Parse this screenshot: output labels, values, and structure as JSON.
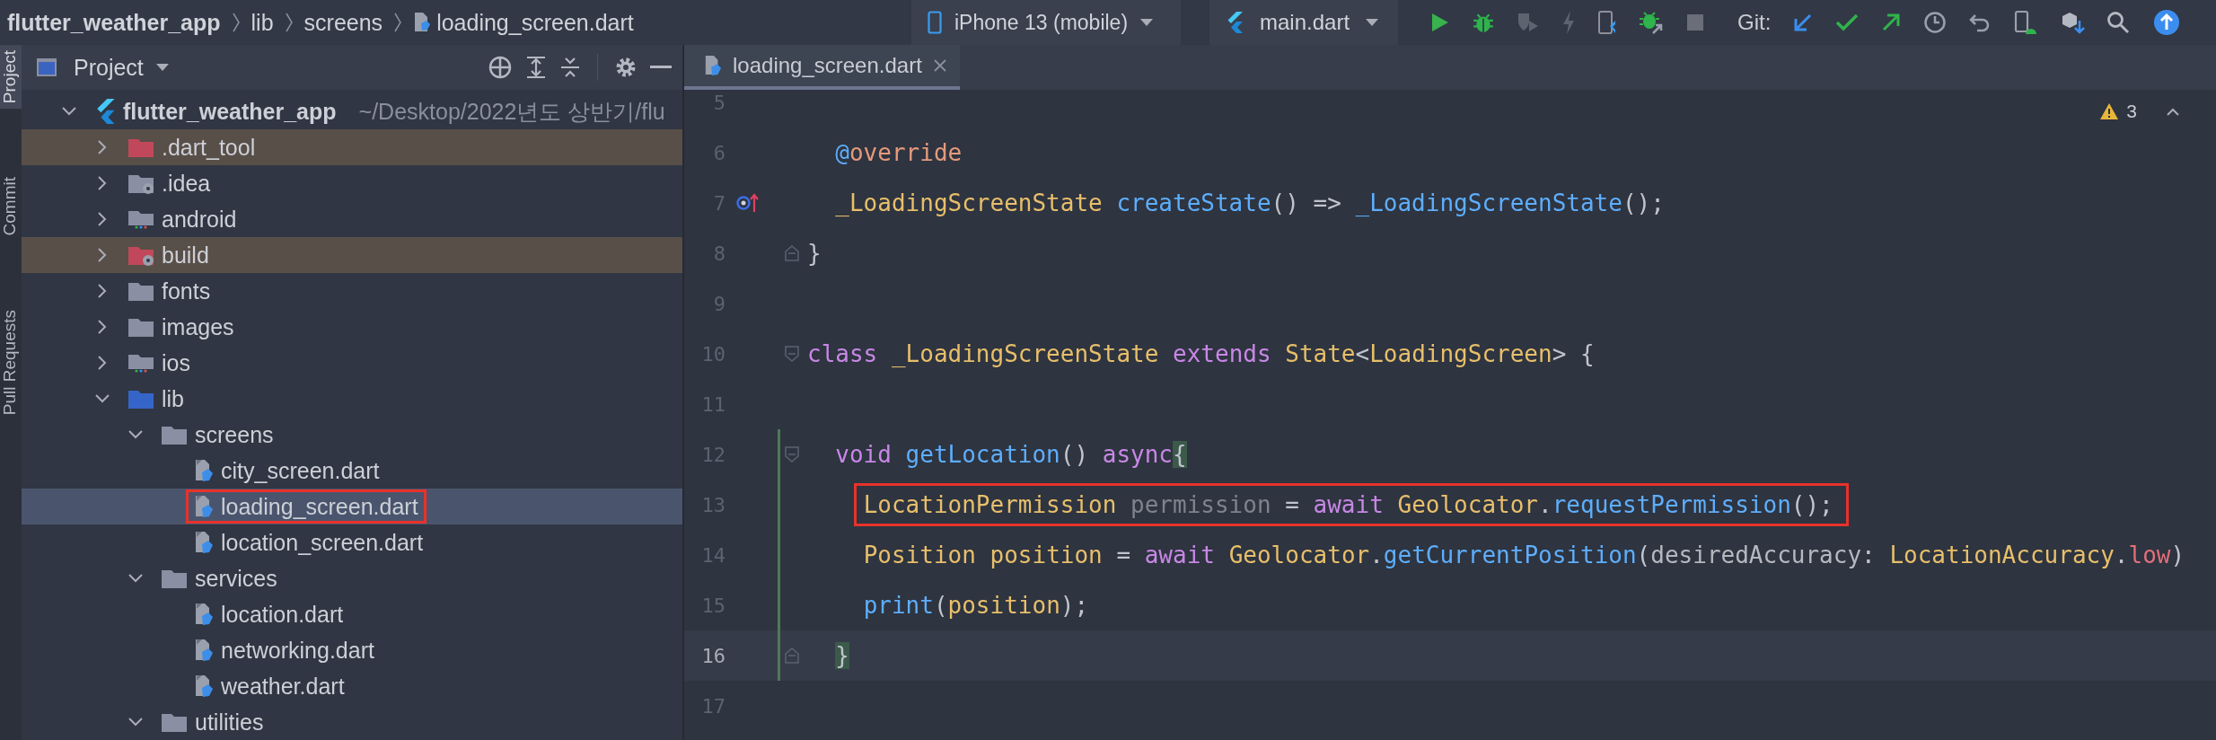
{
  "breadcrumbs": [
    {
      "label": "flutter_weather_app",
      "kind": "project"
    },
    {
      "label": "lib",
      "kind": "folder"
    },
    {
      "label": "screens",
      "kind": "folder"
    },
    {
      "label": "loading_screen.dart",
      "kind": "file"
    }
  ],
  "toolbar": {
    "device": "iPhone 13 (mobile)",
    "config": "main.dart",
    "git_label": "Git:"
  },
  "side_tabs": [
    {
      "label": "Project",
      "selected": true
    },
    {
      "label": "Commit",
      "selected": false
    },
    {
      "label": "Pull Requests",
      "selected": false
    }
  ],
  "panel": {
    "title": "Project"
  },
  "tree": [
    {
      "label": "flutter_weather_app",
      "path": "~/Desktop/2022년도 상반기/flu",
      "kind": "project",
      "expanded": true,
      "children": [
        {
          "label": ".dart_tool",
          "kind": "excluded",
          "expanded": false,
          "excluded": true,
          "selected": false
        },
        {
          "label": ".idea",
          "kind": "settings",
          "expanded": false,
          "excluded": false,
          "selected": false
        },
        {
          "label": "android",
          "kind": "module",
          "expanded": false,
          "excluded": false,
          "selected": false
        },
        {
          "label": "build",
          "kind": "excluded_settings",
          "expanded": false,
          "excluded": true,
          "selected": false
        },
        {
          "label": "fonts",
          "kind": "folder",
          "expanded": false,
          "excluded": false,
          "selected": false
        },
        {
          "label": "images",
          "kind": "folder",
          "expanded": false,
          "excluded": false,
          "selected": false
        },
        {
          "label": "ios",
          "kind": "module",
          "expanded": false,
          "excluded": false,
          "selected": false
        },
        {
          "label": "lib",
          "kind": "source",
          "expanded": true,
          "excluded": false,
          "selected": false,
          "children": [
            {
              "label": "screens",
              "kind": "folder",
              "expanded": true,
              "excluded": false,
              "selected": false,
              "children": [
                {
                  "label": "city_screen.dart",
                  "kind": "dart",
                  "excluded": false,
                  "selected": false
                },
                {
                  "label": "loading_screen.dart",
                  "kind": "dart",
                  "excluded": false,
                  "selected": true
                },
                {
                  "label": "location_screen.dart",
                  "kind": "dart",
                  "excluded": false,
                  "selected": false
                }
              ]
            },
            {
              "label": "services",
              "kind": "folder",
              "expanded": true,
              "excluded": false,
              "selected": false,
              "children": [
                {
                  "label": "location.dart",
                  "kind": "dart",
                  "excluded": false,
                  "selected": false
                },
                {
                  "label": "networking.dart",
                  "kind": "dart",
                  "excluded": false,
                  "selected": false
                },
                {
                  "label": "weather.dart",
                  "kind": "dart",
                  "excluded": false,
                  "selected": false
                }
              ]
            },
            {
              "label": "utilities",
              "kind": "folder",
              "expanded": true,
              "excluded": false,
              "selected": false
            }
          ]
        }
      ]
    }
  ],
  "editor_tabs": [
    {
      "label": "loading_screen.dart",
      "selected": true
    }
  ],
  "warnings": "3",
  "lines": [
    {
      "number": "5"
    },
    {
      "number": "6",
      "tokens": [
        {
          "t": "  @",
          "kind": "ann"
        },
        {
          "t": "override",
          "kind": "meta"
        }
      ]
    },
    {
      "number": "7",
      "override": true,
      "tokens": [
        {
          "t": "  _LoadingScreenState",
          "kind": "type"
        },
        {
          "t": " createState",
          "kind": "fn"
        },
        {
          "t": "() => ",
          "kind": "plain"
        },
        {
          "t": "_LoadingScreenState",
          "kind": "fn"
        },
        {
          "t": "();",
          "kind": "plain"
        }
      ]
    },
    {
      "number": "8",
      "fold_end": true,
      "tokens": [
        {
          "t": "}",
          "kind": "plain"
        }
      ]
    },
    {
      "number": "9"
    },
    {
      "number": "10",
      "fold_start": true,
      "tokens": [
        {
          "t": "class",
          "kind": "kw"
        },
        {
          "t": " _LoadingScreenState",
          "kind": "type"
        },
        {
          "t": " extends",
          "kind": "kw"
        },
        {
          "t": " State",
          "kind": "type"
        },
        {
          "t": "<",
          "kind": "plain"
        },
        {
          "t": "LoadingScreen",
          "kind": "type"
        },
        {
          "t": "> {",
          "kind": "plain"
        }
      ]
    },
    {
      "number": "11"
    },
    {
      "number": "12",
      "fold_start": true,
      "changed": true,
      "tokens": [
        {
          "t": "  void",
          "kind": "kw"
        },
        {
          "t": " getLocation",
          "kind": "fn"
        },
        {
          "t": "() ",
          "kind": "plain"
        },
        {
          "t": "async",
          "kind": "kw"
        },
        {
          "t": "{",
          "kind": "brace"
        }
      ]
    },
    {
      "number": "13",
      "changed": true,
      "boxed": true,
      "tokens": [
        {
          "t": "    LocationPermission",
          "kind": "type"
        },
        {
          "t": " permission",
          "kind": "unused"
        },
        {
          "t": " = ",
          "kind": "plain"
        },
        {
          "t": "await",
          "kind": "kw"
        },
        {
          "t": " Geolocator",
          "kind": "type"
        },
        {
          "t": ".",
          "kind": "plain"
        },
        {
          "t": "requestPermission",
          "kind": "fn"
        },
        {
          "t": "();",
          "kind": "plain"
        }
      ]
    },
    {
      "number": "14",
      "changed": true,
      "tokens": [
        {
          "t": "    Position",
          "kind": "type"
        },
        {
          "t": " position",
          "kind": "var"
        },
        {
          "t": " = ",
          "kind": "plain"
        },
        {
          "t": "await",
          "kind": "kw"
        },
        {
          "t": " Geolocator",
          "kind": "type"
        },
        {
          "t": ".",
          "kind": "plain"
        },
        {
          "t": "getCurrentPosition",
          "kind": "fn"
        },
        {
          "t": "(",
          "kind": "plain"
        },
        {
          "t": "desiredAccuracy",
          "kind": "param"
        },
        {
          "t": ": ",
          "kind": "plain"
        },
        {
          "t": "LocationAccuracy",
          "kind": "type"
        },
        {
          "t": ".",
          "kind": "plain"
        },
        {
          "t": "low",
          "kind": "field"
        },
        {
          "t": ")",
          "kind": "plain"
        }
      ]
    },
    {
      "number": "15",
      "changed": true,
      "tokens": [
        {
          "t": "    print",
          "kind": "fn"
        },
        {
          "t": "(",
          "kind": "plain"
        },
        {
          "t": "position",
          "kind": "var"
        },
        {
          "t": ");",
          "kind": "plain"
        }
      ]
    },
    {
      "number": "16",
      "fold_end": true,
      "changed": true,
      "current": true,
      "tokens": [
        {
          "t": "  }",
          "kind": "brace"
        }
      ]
    },
    {
      "number": "17"
    }
  ]
}
